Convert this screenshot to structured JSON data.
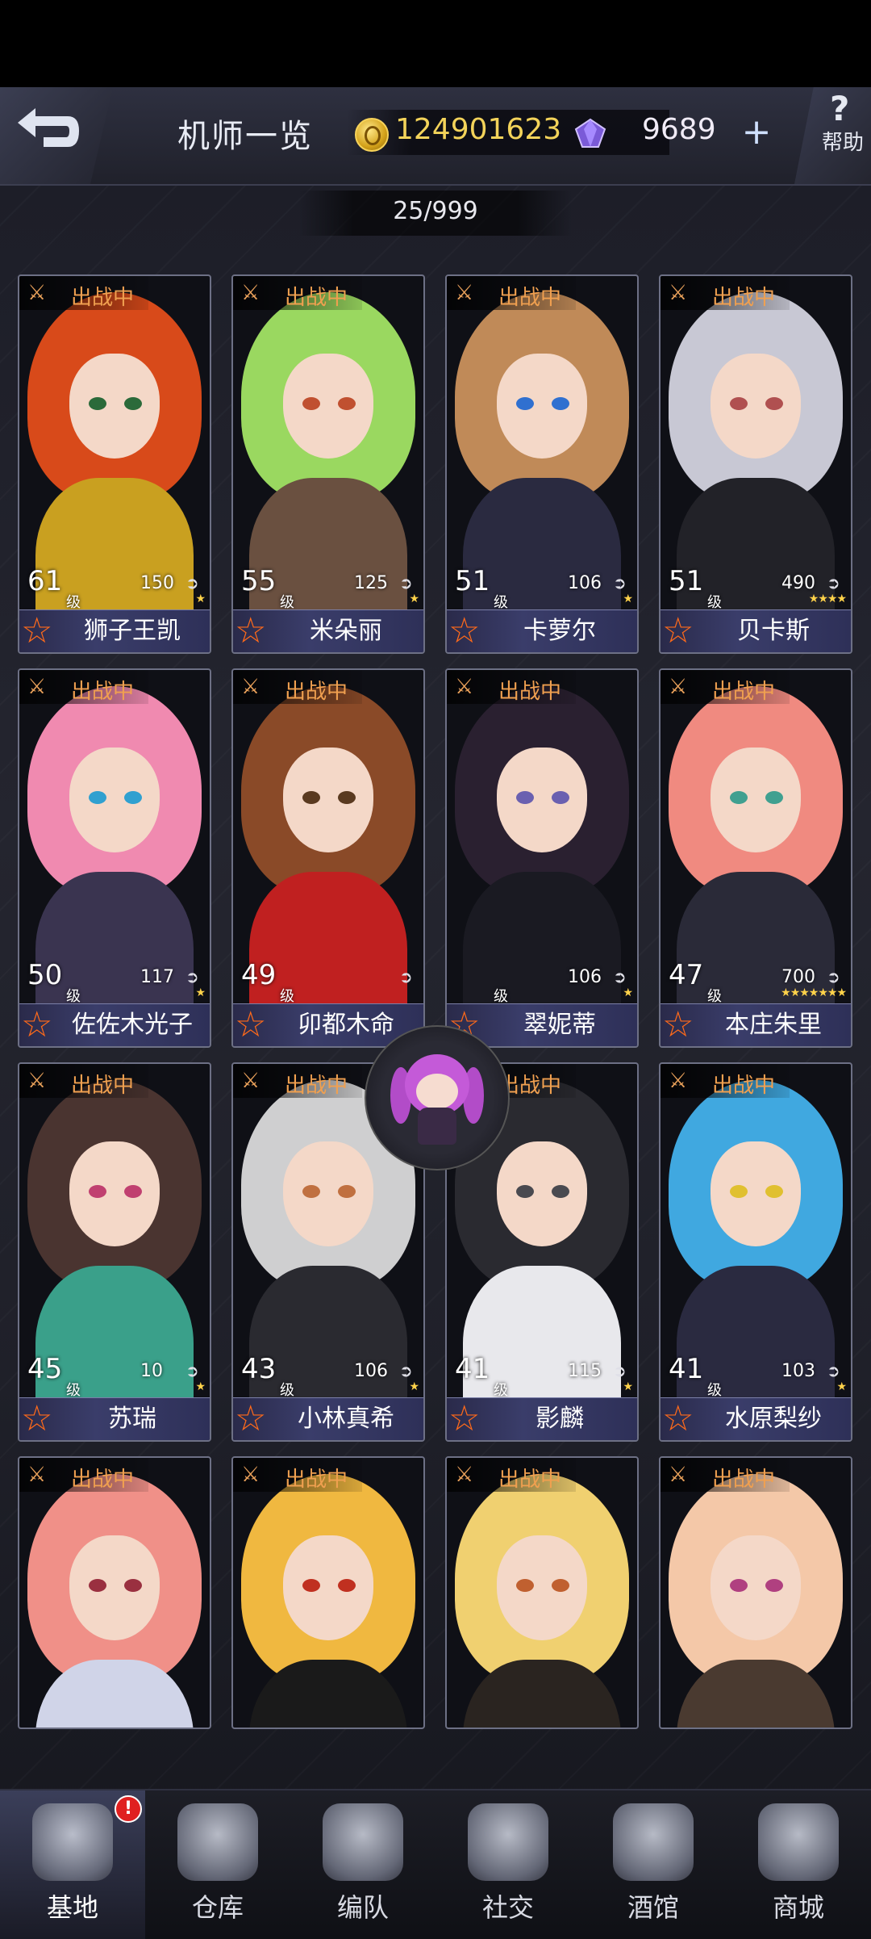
{
  "header": {
    "title": "机师一览",
    "coins": "124901623",
    "gems": "9689",
    "plus_label": "+",
    "help_symbol": "?",
    "help_label": "帮助"
  },
  "counter": "25/999",
  "status_label": "出战中",
  "level_suffix": "级",
  "cards": [
    {
      "name": "狮子王凯",
      "level": "61",
      "power": "150",
      "stars": "★",
      "hair": "#d84a1a",
      "body": "#c9a020",
      "eye": "#2b6a3a"
    },
    {
      "name": "米朵丽",
      "level": "55",
      "power": "125",
      "stars": "★",
      "hair": "#9ad860",
      "body": "#6a5040",
      "eye": "#c05030"
    },
    {
      "name": "卡萝尔",
      "level": "51",
      "power": "106",
      "stars": "★",
      "hair": "#c08a58",
      "body": "#2a2a40",
      "eye": "#3070d0"
    },
    {
      "name": "贝卡斯",
      "level": "51",
      "power": "490",
      "stars": "★★★★",
      "hair": "#c8c8d4",
      "body": "#222228",
      "eye": "#b05050"
    },
    {
      "name": "佐佐木光子",
      "level": "50",
      "power": "117",
      "stars": "★",
      "hair": "#f08ab0",
      "body": "#3a3450",
      "eye": "#30a0d0"
    },
    {
      "name": "卯都木命",
      "level": "49",
      "power": "",
      "stars": "",
      "hair": "#8a4a28",
      "body": "#c02020",
      "eye": "#5a3a20"
    },
    {
      "name": "翠妮蒂",
      "level": "",
      "power": "106",
      "stars": "★",
      "hair": "#2a2030",
      "body": "#1a1a22",
      "eye": "#6a60b0"
    },
    {
      "name": "本庄朱里",
      "level": "47",
      "power": "700",
      "stars": "★★★★★★★",
      "hair": "#f08a80",
      "body": "#2a2a38",
      "eye": "#40a090"
    },
    {
      "name": "苏瑞",
      "level": "45",
      "power": "10",
      "stars": "★",
      "hair": "#4a3430",
      "body": "#3aa08a",
      "eye": "#c04070"
    },
    {
      "name": "小林真希",
      "level": "43",
      "power": "106",
      "stars": "★",
      "hair": "#cfcfd0",
      "body": "#2a2a30",
      "eye": "#c07040"
    },
    {
      "name": "影麟",
      "level": "41",
      "power": "115",
      "stars": "★",
      "hair": "#2a2a30",
      "body": "#e8e8ec",
      "eye": "#4a4a50"
    },
    {
      "name": "水原梨纱",
      "level": "41",
      "power": "103",
      "stars": "★",
      "hair": "#40a8e0",
      "body": "#2a2a40",
      "eye": "#e0c030"
    },
    {
      "name": "",
      "level": "",
      "power": "",
      "stars": "",
      "hair": "#f09088",
      "body": "#d0d4e8",
      "eye": "#9a3040"
    },
    {
      "name": "",
      "level": "",
      "power": "",
      "stars": "",
      "hair": "#f0b840",
      "body": "#1a1a1a",
      "eye": "#c03020"
    },
    {
      "name": "",
      "level": "",
      "power": "",
      "stars": "",
      "hair": "#f0d070",
      "body": "#2a2420",
      "eye": "#c06030"
    },
    {
      "name": "",
      "level": "",
      "power": "",
      "stars": "",
      "hair": "#f4c8a8",
      "body": "#4a3a30",
      "eye": "#b04080"
    }
  ],
  "bottom_nav": [
    {
      "label": "基地",
      "icon": "base-icon",
      "active": true,
      "badge": "!"
    },
    {
      "label": "仓库",
      "icon": "warehouse-icon"
    },
    {
      "label": "编队",
      "icon": "formation-icon"
    },
    {
      "label": "社交",
      "icon": "handshake-icon"
    },
    {
      "label": "酒馆",
      "icon": "tavern-icon"
    },
    {
      "label": "商城",
      "icon": "shop-icon"
    }
  ],
  "colors": {
    "accent_orange": "#f0a050",
    "coin_gold": "#f3d35a"
  }
}
